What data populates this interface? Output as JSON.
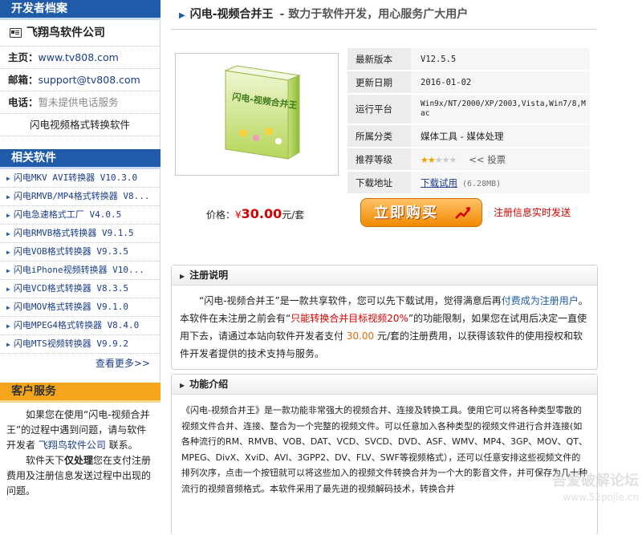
{
  "sidebar": {
    "dev_title": "开发者档案",
    "company": "飞翔鸟软件公司",
    "homepage_label": "主页：",
    "homepage_url": "www.tv808.com",
    "email_label": "邮箱：",
    "email": "support@tv808.com",
    "phone_label": "电话：",
    "phone_value": "暂未提供电话服务",
    "product_line": "闪电视频格式转换软件",
    "related_title": "相关软件",
    "related": [
      "闪电MKV AVI转换器 V10.3.0",
      "闪电RMVB/MP4格式转换器 V8...",
      "闪电急速格式工厂 V4.0.5",
      "闪电RMVB格式转换器 V9.1.5",
      "闪电VOB格式转换器 V9.3.5",
      "闪电iPhone视频转换器 V10...",
      "闪电VCD格式转换器 V8.3.5",
      "闪电MOV格式转换器 V9.1.0",
      "闪电MPEG4格式转换器 V8.4.0",
      "闪电MTS视频转换器 V9.9.2"
    ],
    "more": "查看更多>>",
    "service_title": "客户服务",
    "service_p1_a": "如果您在使用“闪电-视频合并王”的过程中遇到问题，请与软件开发者 ",
    "service_p1_link": "飞翔鸟软件公司",
    "service_p1_b": " 联系。",
    "service_p2_a": "软件天下",
    "service_p2_bold": "仅处理",
    "service_p2_b": "您在支付注册费用及注册信息发送过程中出现的问题。"
  },
  "header": {
    "name": "闪电-视频合并王",
    "slogan": "- 致力于软件开发，用心服务广大用户"
  },
  "product": {
    "box_label": "闪电-视频合并王"
  },
  "info": {
    "version_label": "最新版本",
    "version": "V12.5.5",
    "updated_label": "更新日期",
    "updated": "2016-01-02",
    "platform_label": "运行平台",
    "platform": "Win9x/NT/2000/XP/2003,Vista,Win7/8,Mac",
    "category_label": "所属分类",
    "category": "媒体工具 - 媒体处理",
    "rating_label": "推荐等级",
    "rating": 2,
    "rating_max": 5,
    "vote": "<< 投票",
    "download_label": "下载地址",
    "download_link": "下载试用",
    "download_size": "(6.28MB)"
  },
  "purchase": {
    "price_label": "价格：",
    "currency": "¥",
    "price": "30.00",
    "unit": "元/套",
    "buy_label": "立即购买",
    "reg_note": "注册信息实时发送"
  },
  "reg_section": {
    "title": "注册说明",
    "p_a": "“闪电-视频合并王”是一款共享软件，您可以先下载试用，觉得满意后再",
    "p_pay": "付费成为注册用户",
    "p_b": "。本软件在未注册之前会有“",
    "p_limit": "只能转换合并目标视频20%",
    "p_c": "”的功能限制，如果您在试用后决定一直使用下去，请通过本站向软件开发者支付 ",
    "p_price": "30.00",
    "p_d": " 元/套的注册费用，以获得该软件的使用授权和软件开发者提供的技术支持与服务。"
  },
  "func_section": {
    "title": "功能介绍",
    "text": "《闪电-视频合并王》是一款功能非常强大的视频合并、连接及转换工具。使用它可以将各种类型零散的视频文件合并、连接、整合为一个完整的视频文件。可以任意加入各种类型的视频文件进行合并连接(如各种流行的RM、RMVB、VOB、DAT、VCD、SVCD、DVD、ASF、WMV、MP4、3GP、MOV、QT、MPEG、DivX、XviD、AVI、3GPP2、DV、FLV、SWF等视频格式），还可以任意安排这些视频文件的排列次序，点击一个按钮就可以将这些加入的视频文件转换合并为一个大的影音文件，并可保存为几十种流行的视频音频格式。本软件采用了最先进的视频解码技术，转换合并"
  },
  "watermark": {
    "line1": "吾爱破解论坛",
    "line2": "www.52pojie.cn"
  }
}
